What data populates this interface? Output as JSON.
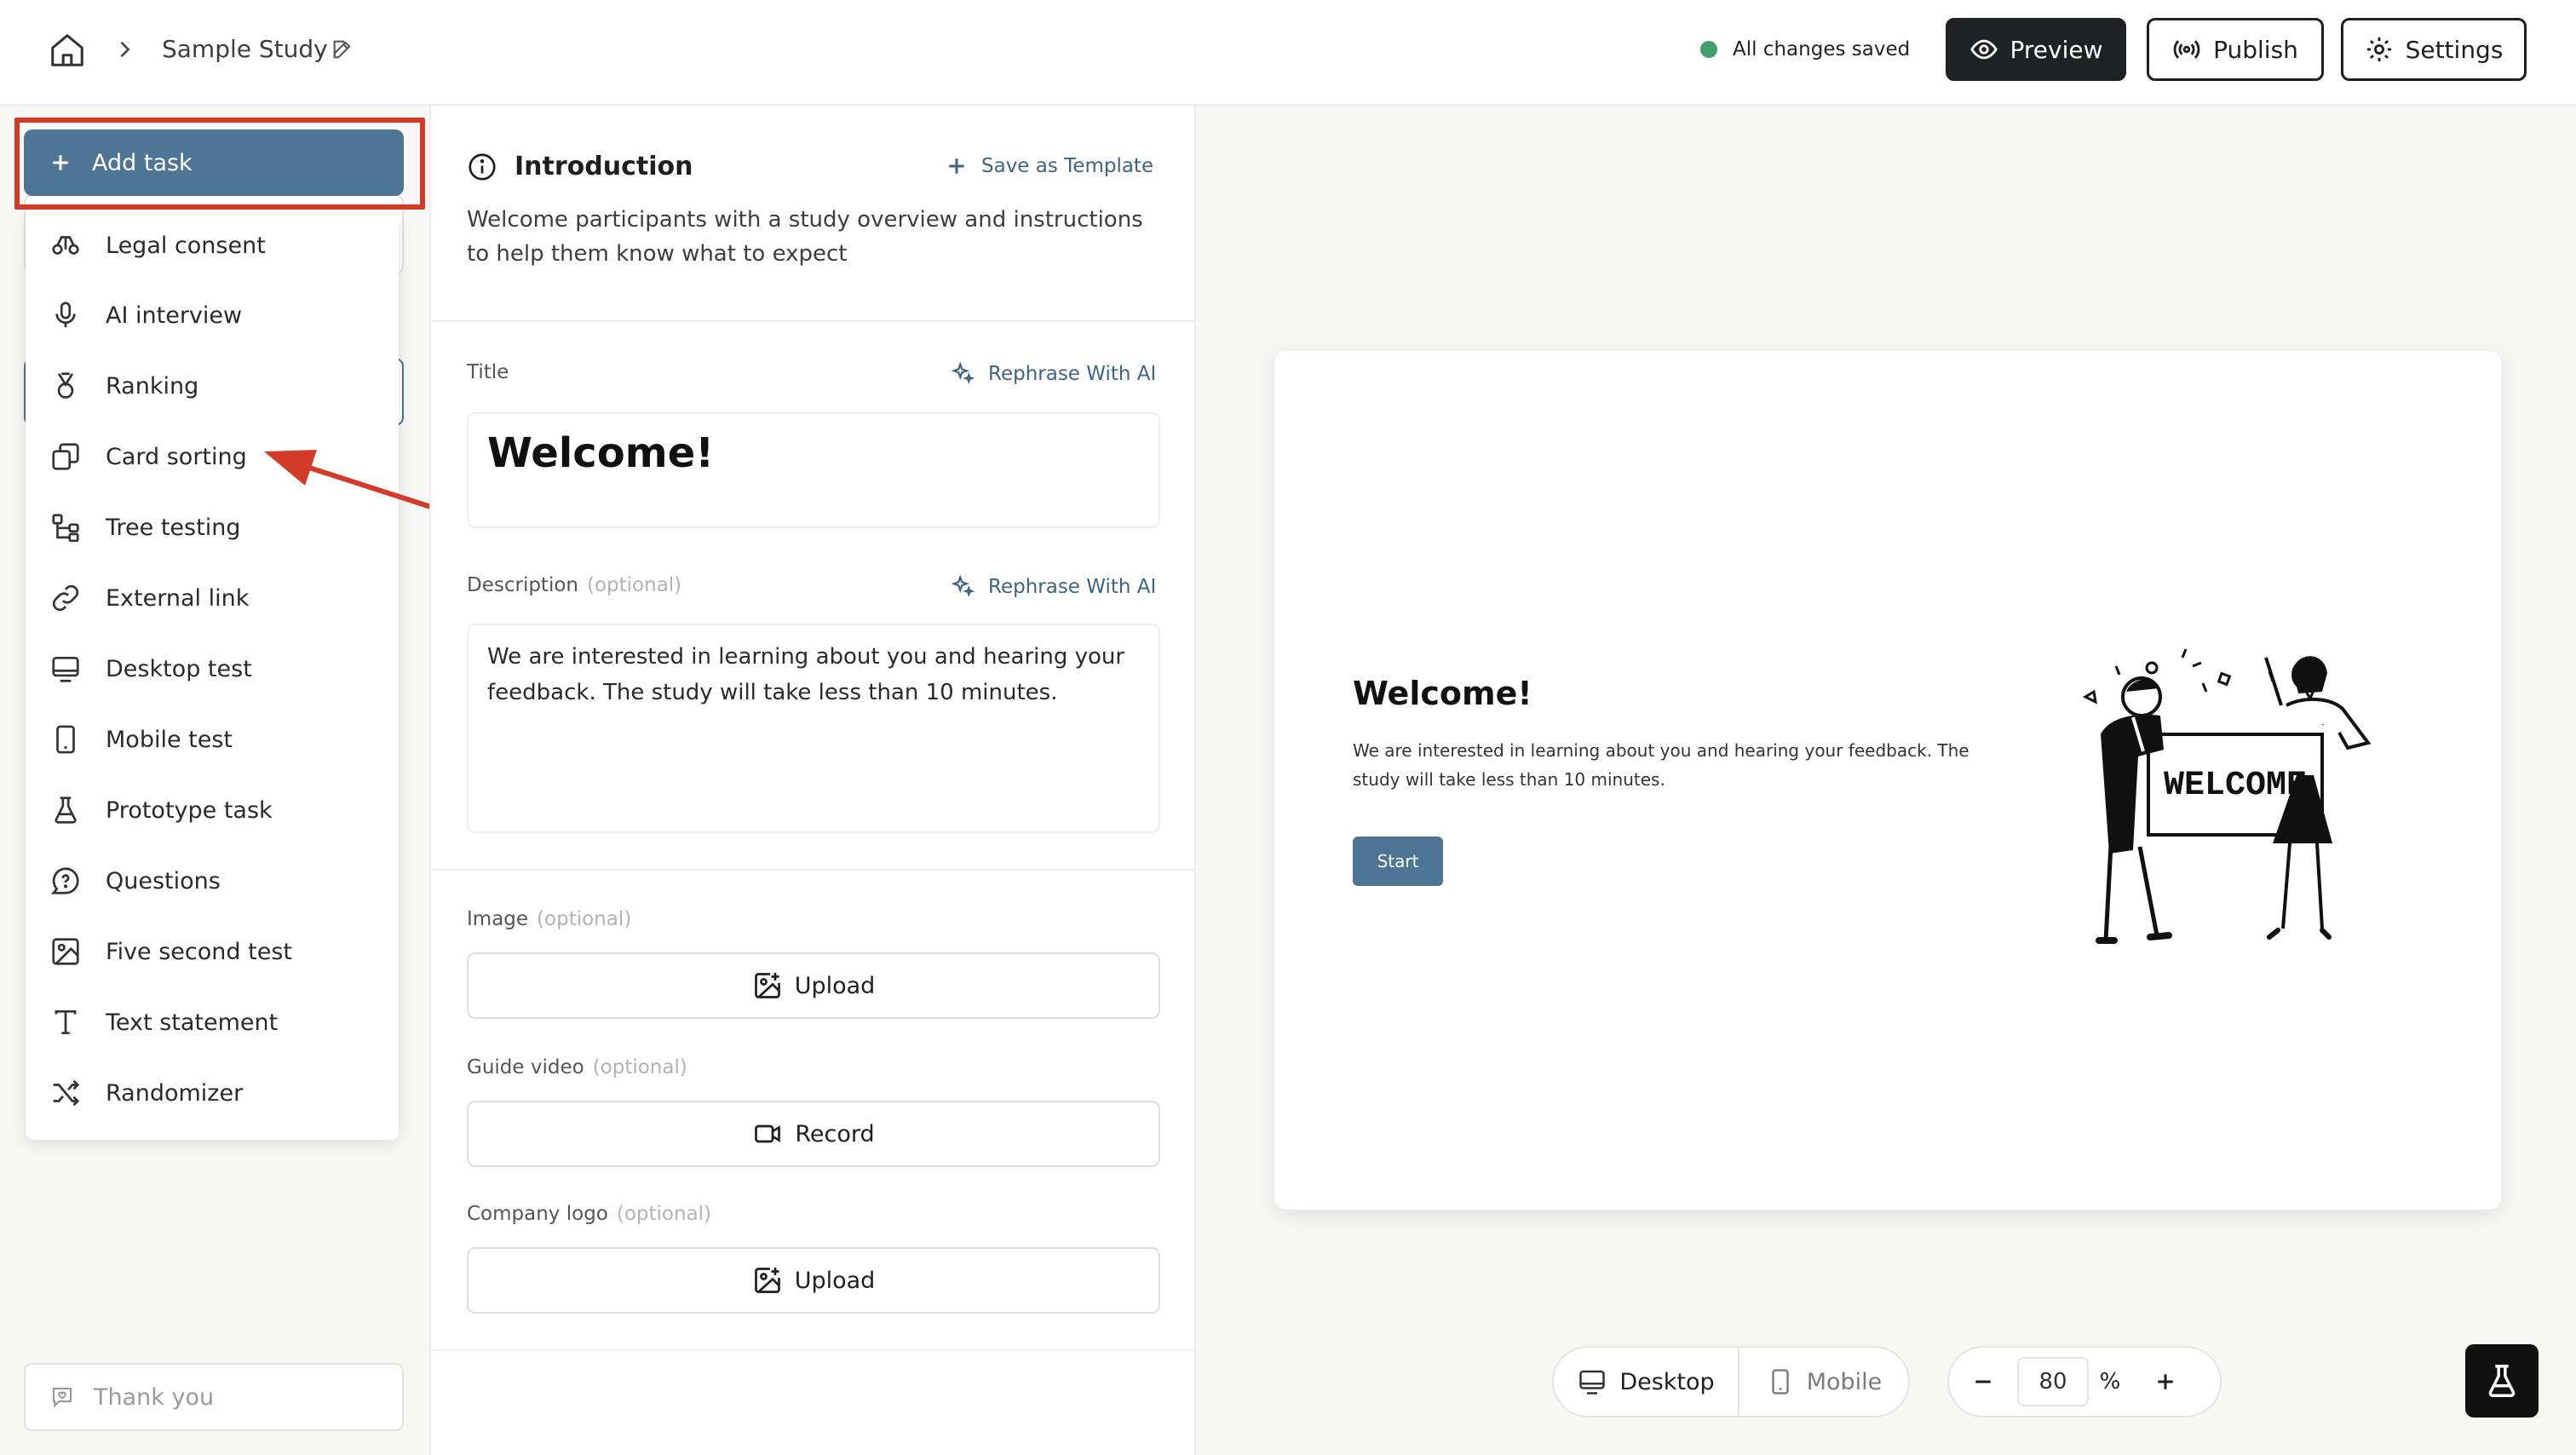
{
  "header": {
    "breadcrumb_study": "Sample Study",
    "save_status": "All changes saved",
    "preview_label": "Preview",
    "publish_label": "Publish",
    "settings_label": "Settings"
  },
  "sidebar": {
    "add_task_label": "Add task",
    "menu_items": [
      {
        "label": "Legal consent",
        "icon": "scale-icon"
      },
      {
        "label": "AI interview",
        "icon": "microphone-icon"
      },
      {
        "label": "Ranking",
        "icon": "medal-icon"
      },
      {
        "label": "Card sorting",
        "icon": "cards-icon"
      },
      {
        "label": "Tree testing",
        "icon": "tree-icon"
      },
      {
        "label": "External link",
        "icon": "link-icon"
      },
      {
        "label": "Desktop test",
        "icon": "monitor-icon"
      },
      {
        "label": "Mobile test",
        "icon": "phone-icon"
      },
      {
        "label": "Prototype task",
        "icon": "flask-icon"
      },
      {
        "label": "Questions",
        "icon": "question-bubble-icon"
      },
      {
        "label": "Five second test",
        "icon": "image-icon"
      },
      {
        "label": "Text statement",
        "icon": "text-icon"
      },
      {
        "label": "Randomizer",
        "icon": "shuffle-icon"
      }
    ],
    "thank_you_label": "Thank you"
  },
  "editor": {
    "section_title": "Introduction",
    "save_template_label": "Save as Template",
    "section_description": "Welcome participants with a study overview and instructions to help them know what to expect",
    "title_label": "Title",
    "rephrase_label": "Rephrase With AI",
    "title_value": "Welcome!",
    "description_label": "Description",
    "optional_label": "(optional)",
    "description_value": "We are interested in learning about you and hearing your feedback. The study will take less than 10 minutes.",
    "image_label": "Image",
    "upload_label": "Upload",
    "guide_video_label": "Guide video",
    "record_label": "Record",
    "company_logo_label": "Company logo"
  },
  "preview": {
    "title": "Welcome!",
    "description": "We are interested in learning about you and hearing your feedback. The study will take less than 10 minutes.",
    "start_label": "Start",
    "illustration_sign_text": "WELCOME"
  },
  "bottom": {
    "desktop_label": "Desktop",
    "mobile_label": "Mobile",
    "zoom_value": "80",
    "zoom_unit": "%"
  },
  "colors": {
    "accent": "#4e7593",
    "annotation_red": "#d33a27",
    "saved_green": "#3f9e6b"
  }
}
